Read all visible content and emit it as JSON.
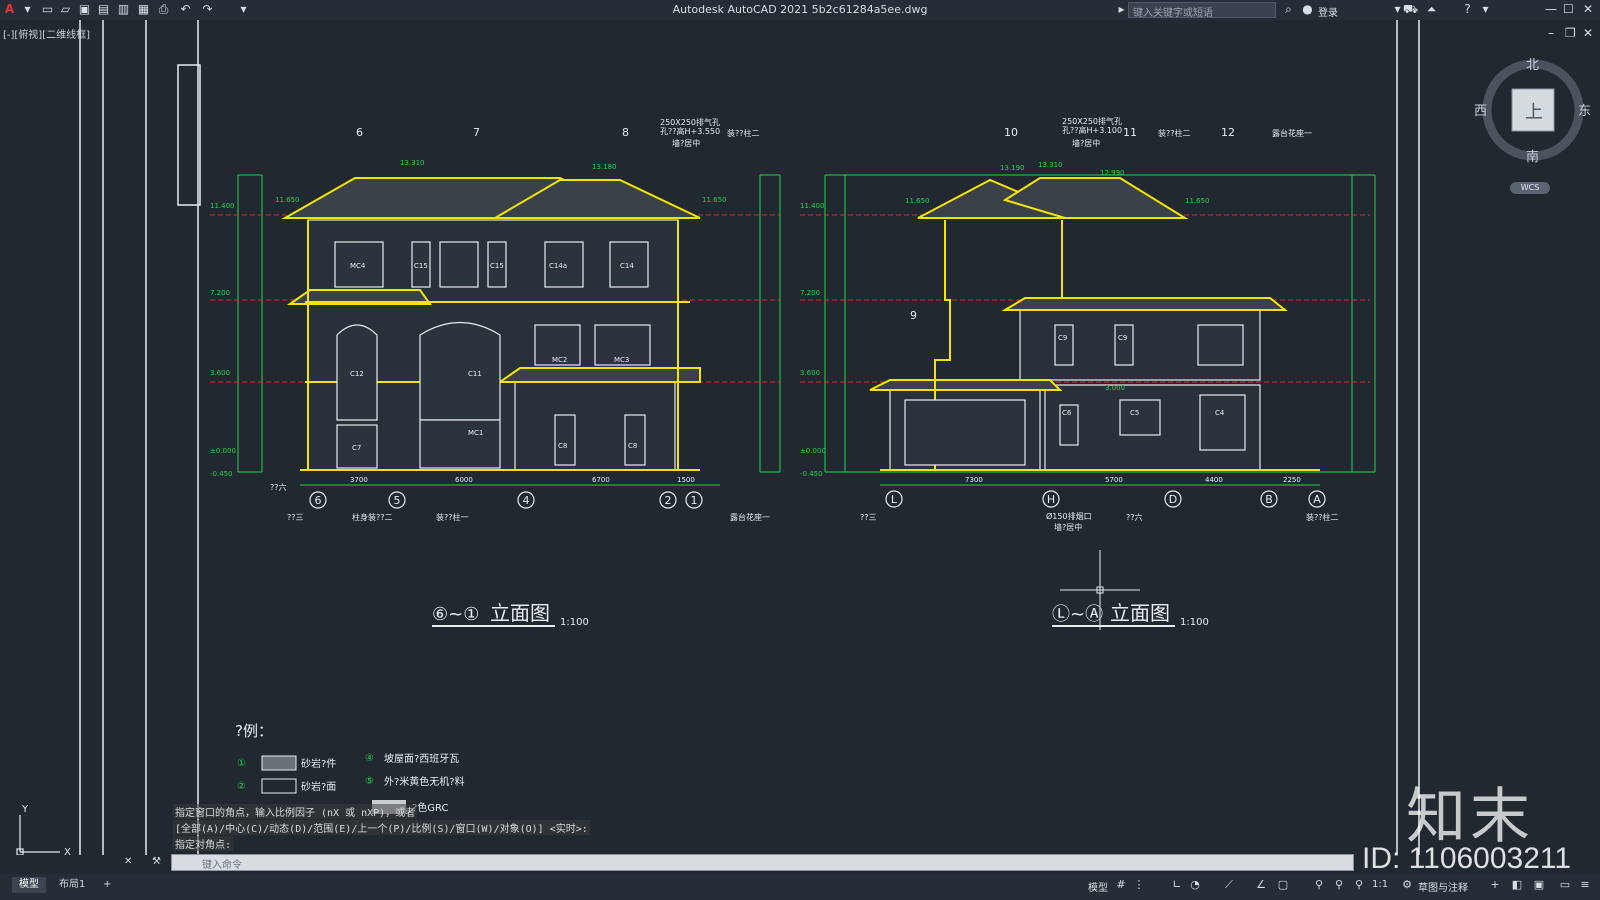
{
  "window": {
    "title": "Autodesk AutoCAD 2021    5b2c61284a5ee.dwg",
    "search_placeholder": "键入关键字或短语",
    "login": "登录",
    "view_label": "[-][俯视][二维线框]"
  },
  "viewcube": {
    "north": "北",
    "south": "南",
    "west": "西",
    "east": "东",
    "face": "上",
    "wcs": "WCS"
  },
  "drawing": {
    "left_elevation": {
      "title_axes": "⑥~①",
      "title_text": "立面图",
      "scale": "1:100",
      "top_labels": [
        "6",
        "7",
        "8"
      ],
      "top_note1": "250X250排气孔",
      "top_note2": "孔??高H+3.550",
      "top_note3": "墙?居中",
      "top_note4": "装??柱二",
      "axis_labels": [
        "6",
        "5",
        "4",
        "2",
        "1"
      ],
      "dims": [
        "3700",
        "6000",
        "6700",
        "1500"
      ],
      "levels": [
        "11.400",
        "7.200",
        "3.600",
        "±0.000",
        "-0.450"
      ],
      "roof_levels": [
        "13.310",
        "13.180",
        "11.650",
        "11.650"
      ],
      "windows": [
        "MC4",
        "C15",
        "C15",
        "C14a",
        "C14",
        "C12",
        "C11",
        "MC2",
        "MC3",
        "MC1",
        "C7",
        "C8",
        "C8"
      ],
      "bottom_notes": [
        "??六",
        "??三",
        "柱身装??二",
        "装??柱一",
        "露台花座一"
      ]
    },
    "right_elevation": {
      "title_axes": "Ⓛ~Ⓐ",
      "title_text": "立面图",
      "scale": "1:100",
      "top_labels": [
        "10",
        "11",
        "12",
        "9"
      ],
      "top_note1": "250X250排气孔",
      "top_note2": "孔??高H+3.100",
      "top_note3": "墙?居中",
      "top_note4": "装??柱二",
      "top_note5": "露台花座一",
      "axis_labels": [
        "L",
        "H",
        "D",
        "B",
        "A"
      ],
      "dims": [
        "7300",
        "5700",
        "4400",
        "2250"
      ],
      "levels": [
        "11.400",
        "7.200",
        "3.600",
        "±0.000",
        "-0.450"
      ],
      "roof_levels": [
        "13.190",
        "13.310",
        "12.990",
        "11.650",
        "11.650",
        "3.000"
      ],
      "windows": [
        "C9",
        "C9",
        "C6",
        "C5",
        "C4"
      ],
      "bottom_notes": [
        "??三",
        "Ø150排烟口",
        "墙?居中",
        "??六",
        "装??柱二"
      ]
    },
    "legend": {
      "title": "?例：",
      "items": [
        {
          "num": "①",
          "text": "砂岩?件"
        },
        {
          "num": "②",
          "text": "砂岩?面"
        },
        {
          "num": "④",
          "text": "坡屋面?西班牙瓦"
        },
        {
          "num": "⑤",
          "text": "外?米黄色无机?料"
        },
        {
          "num": "",
          "text": "?色GRC"
        }
      ]
    }
  },
  "command": {
    "history": [
      "指定窗口的角点，输入比例因子 (nX 或 nXP)，或者",
      "[全部(A)/中心(C)/动态(D)/范围(E)/上一个(P)/比例(S)/窗口(W)/对象(O)] <实时>:",
      "指定对角点:"
    ],
    "input_placeholder": "键入命令"
  },
  "statusbar": {
    "tabs": [
      "模型",
      "布局1",
      "+"
    ],
    "model_label": "模型",
    "scale": "1:1",
    "workspace": "草图与注释"
  },
  "watermark": {
    "brand": "知末",
    "id": "ID: 1106003211"
  },
  "colors": {
    "background": "#212830",
    "green": "#22d34a",
    "yellow": "#f2e600",
    "white": "#e8ecef",
    "magenta": "#c03de0",
    "red": "#e02b2b"
  }
}
